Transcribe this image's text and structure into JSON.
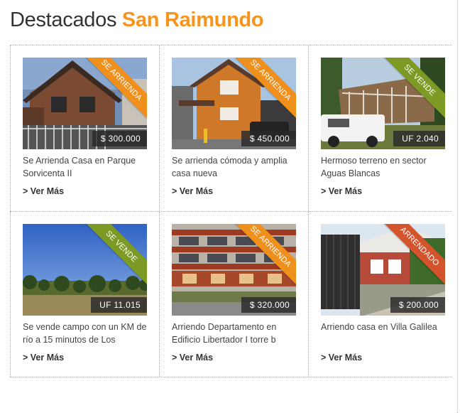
{
  "header": {
    "title_prefix": "Destacados",
    "title_accent": "San Raimundo"
  },
  "colors": {
    "accent": "#f7941d",
    "ribbon_rent": "#f0901c",
    "ribbon_sale": "#7d9a24",
    "ribbon_rented": "#d2532c"
  },
  "listings": [
    {
      "ribbon": "SE ARRIENDA",
      "price": "$ 300.000",
      "title": "Se Arrienda Casa en Parque Sorvicenta II",
      "more": "> Ver Más"
    },
    {
      "ribbon": "SE ARRIENDA",
      "price": "$ 450.000",
      "title": "Se arrienda cómoda y amplia casa nueva",
      "more": "> Ver Más"
    },
    {
      "ribbon": "SE VENDE",
      "price": "UF 2.040",
      "title": "Hermoso terreno en sector Aguas Blancas",
      "more": "> Ver Más"
    },
    {
      "ribbon": "SE VENDE",
      "price": "UF 11.015",
      "title": "Se vende campo con un KM de río a 15 minutos de Los",
      "more": "> Ver Más"
    },
    {
      "ribbon": "SE ARRIENDA",
      "price": "$ 320.000",
      "title": "Arriendo Departamento en Edificio Libertador I torre b",
      "more": "> Ver Más"
    },
    {
      "ribbon": "ARRENDADO",
      "price": "$ 200.000",
      "title": "Arriendo casa en Villa Galilea",
      "more": "> Ver Más"
    }
  ]
}
